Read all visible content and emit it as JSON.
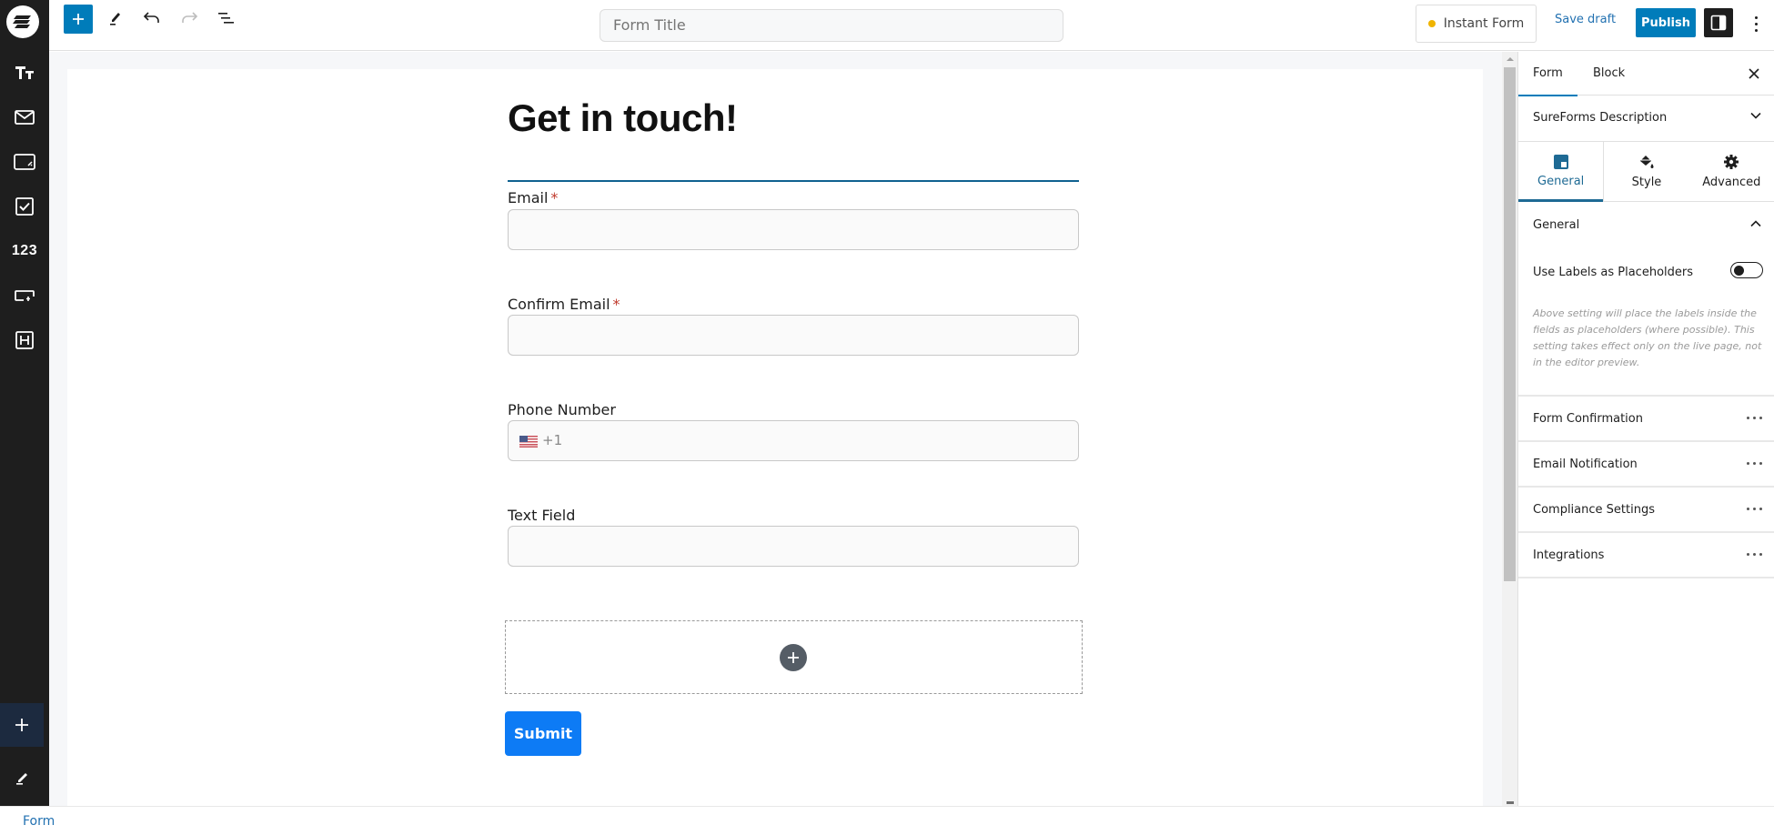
{
  "topbar": {
    "form_title_placeholder": "Form Title",
    "form_title_value": "",
    "instant_form_label": "Instant Form",
    "save_draft_label": "Save draft",
    "publish_label": "Publish",
    "status_dot_color": "#f0b400"
  },
  "sidebar": {
    "items": [
      {
        "icon": "text-icon"
      },
      {
        "icon": "email-icon"
      },
      {
        "icon": "textarea-icon"
      },
      {
        "icon": "checkbox-icon"
      },
      {
        "icon": "number-icon",
        "label": "123"
      },
      {
        "icon": "input-icon"
      },
      {
        "icon": "heading-icon"
      }
    ]
  },
  "form": {
    "heading": "Get in touch!",
    "fields": [
      {
        "label": "Email",
        "required": true,
        "required_mark": "*",
        "value": ""
      },
      {
        "label": "Confirm Email",
        "required": true,
        "required_mark": "*",
        "value": ""
      },
      {
        "label": "Phone Number",
        "required": false,
        "country_code": "+1",
        "value": ""
      },
      {
        "label": "Text Field",
        "required": false,
        "value": ""
      }
    ],
    "submit_label": "Submit"
  },
  "panel": {
    "tabs": [
      {
        "label": "Form",
        "active": true
      },
      {
        "label": "Block",
        "active": false
      }
    ],
    "description_title": "SureForms Description",
    "subtabs": [
      {
        "label": "General",
        "selected": true
      },
      {
        "label": "Style",
        "selected": false
      },
      {
        "label": "Advanced",
        "selected": false
      }
    ],
    "general": {
      "title": "General",
      "toggle_label": "Use Labels as Placeholders",
      "toggle_on": false,
      "help_text": "Above setting will place the labels inside the fields as placeholders (where possible). This setting takes effect only on the live page, not in the editor preview."
    },
    "settings": [
      {
        "label": "Form Confirmation"
      },
      {
        "label": "Email Notification"
      },
      {
        "label": "Compliance Settings"
      },
      {
        "label": "Integrations"
      }
    ]
  },
  "footer": {
    "breadcrumb": "Form"
  },
  "colors": {
    "accent": "#007cba",
    "submit": "#0d7bf5",
    "heading_rule": "#0f6290",
    "sidebar_bg": "#1e1e1e"
  }
}
